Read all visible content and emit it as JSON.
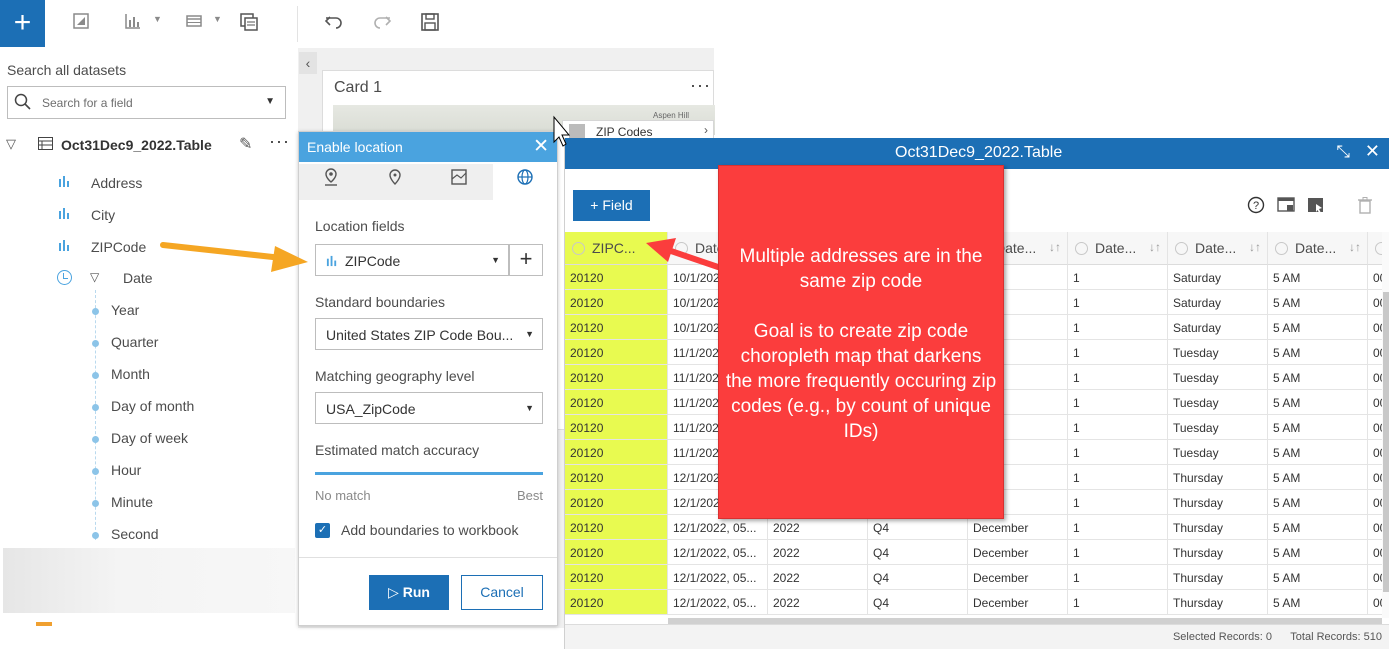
{
  "toolbar": {
    "add_label": "+",
    "icons": [
      "card-icon",
      "chart-icon",
      "table-icon",
      "page-icon",
      "undo-icon",
      "redo-icon",
      "save-icon"
    ]
  },
  "data_panel": {
    "search_label": "Search all datasets",
    "search_placeholder": "Search for a field",
    "dataset_name": "Oct31Dec9_2022.Table",
    "fields": [
      "Address",
      "City",
      "ZIPCode"
    ],
    "date_field": "Date",
    "date_subfields": [
      "Year",
      "Quarter",
      "Month",
      "Day of month",
      "Day of week",
      "Hour",
      "Minute",
      "Second"
    ]
  },
  "card": {
    "title": "Card 1",
    "map_label": "Aspen Hill",
    "zip_pill": "ZIP Codes"
  },
  "enable_location": {
    "title": "Enable location",
    "location_fields_label": "Location fields",
    "location_field_value": "ZIPCode",
    "standard_boundaries_label": "Standard boundaries",
    "standard_boundaries_value": "United States ZIP Code Bou...",
    "matching_level_label": "Matching geography level",
    "matching_level_value": "USA_ZipCode",
    "accuracy_label": "Estimated match accuracy",
    "no_match": "No match",
    "best": "Best",
    "add_boundaries_label": "Add boundaries to workbook",
    "run_label": "Run",
    "cancel_label": "Cancel"
  },
  "table_window": {
    "title": "Oct31Dec9_2022.Table",
    "field_button": "Field",
    "headers": [
      "ZIPC...",
      "Date",
      "",
      "",
      "Date...",
      "Date...",
      "Date...",
      "Date...",
      ""
    ],
    "rows": [
      [
        "20120",
        "10/1/2022",
        "",
        "",
        "ber",
        "1",
        "Saturday",
        "5 AM",
        "00"
      ],
      [
        "20120",
        "10/1/2022",
        "",
        "",
        "ber",
        "1",
        "Saturday",
        "5 AM",
        "00"
      ],
      [
        "20120",
        "10/1/2022",
        "",
        "",
        "ber",
        "1",
        "Saturday",
        "5 AM",
        "00"
      ],
      [
        "20120",
        "11/1/2022",
        "",
        "",
        "mber",
        "1",
        "Tuesday",
        "5 AM",
        "00"
      ],
      [
        "20120",
        "11/1/2022",
        "",
        "",
        "mber",
        "1",
        "Tuesday",
        "5 AM",
        "00"
      ],
      [
        "20120",
        "11/1/2022",
        "",
        "",
        "mber",
        "1",
        "Tuesday",
        "5 AM",
        "00"
      ],
      [
        "20120",
        "11/1/2022",
        "",
        "",
        "mber",
        "1",
        "Tuesday",
        "5 AM",
        "00"
      ],
      [
        "20120",
        "11/1/2022",
        "",
        "",
        "mber",
        "1",
        "Tuesday",
        "5 AM",
        "00"
      ],
      [
        "20120",
        "12/1/2022",
        "",
        "",
        "mber",
        "1",
        "Thursday",
        "5 AM",
        "00"
      ],
      [
        "20120",
        "12/1/2022",
        "",
        "",
        "mber",
        "1",
        "Thursday",
        "5 AM",
        "00"
      ],
      [
        "20120",
        "12/1/2022, 05...",
        "2022",
        "Q4",
        "December",
        "1",
        "Thursday",
        "5 AM",
        "00"
      ],
      [
        "20120",
        "12/1/2022, 05...",
        "2022",
        "Q4",
        "December",
        "1",
        "Thursday",
        "5 AM",
        "00"
      ],
      [
        "20120",
        "12/1/2022, 05...",
        "2022",
        "Q4",
        "December",
        "1",
        "Thursday",
        "5 AM",
        "00"
      ],
      [
        "20120",
        "12/1/2022, 05...",
        "2022",
        "Q4",
        "December",
        "1",
        "Thursday",
        "5 AM",
        "00"
      ]
    ],
    "selected_records": "Selected Records: 0",
    "total_records": "Total Records: 510"
  },
  "callout": {
    "line1": "Multiple addresses are in the same zip code",
    "line2": "Goal is to create zip code choropleth map that darkens the more frequently occuring zip codes (e.g., by count of unique IDs)"
  },
  "colors": {
    "brand_blue": "#1c6fb5",
    "light_blue": "#4aa3df",
    "callout_red": "#fb3d3d",
    "arrow_orange": "#f5a623",
    "highlight_yellow": "#e8fa50"
  }
}
